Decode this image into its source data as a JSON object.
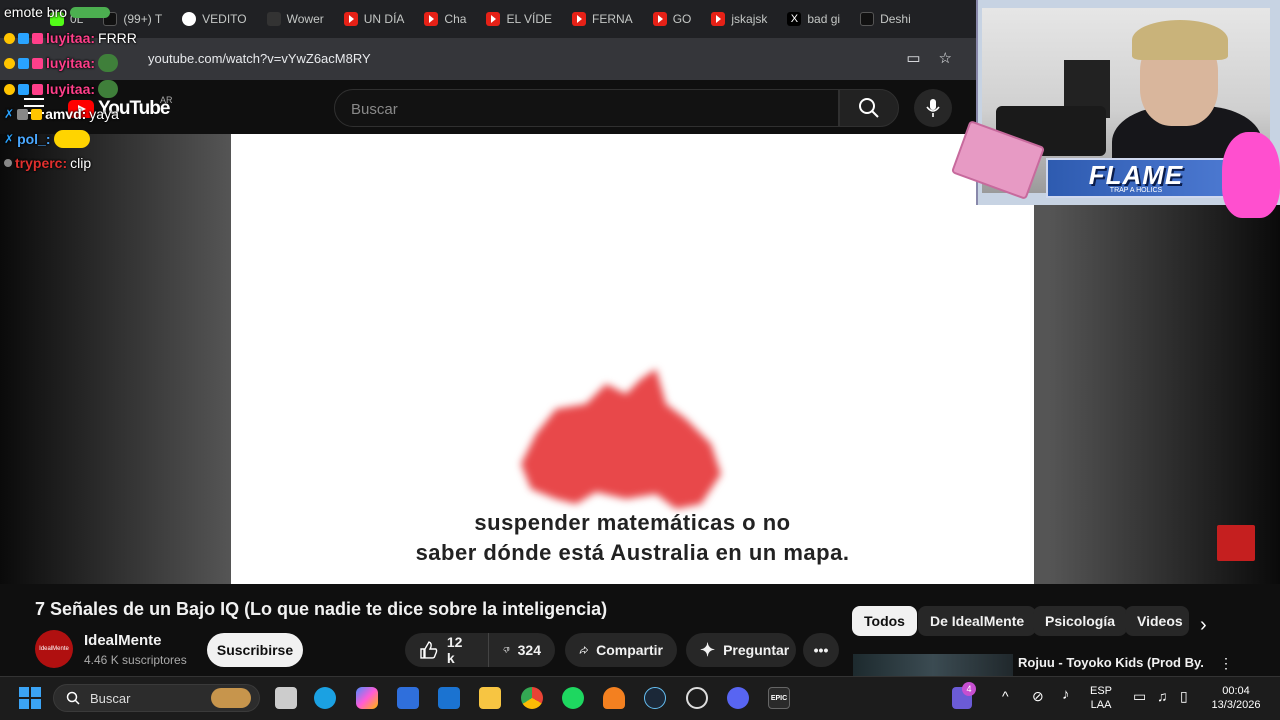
{
  "browser": {
    "tabs": [
      {
        "label": "0L",
        "icon": "kick-icon"
      },
      {
        "label": "(99+) T",
        "icon": "tiktok-icon"
      },
      {
        "label": "VEDITO",
        "icon": "google-icon"
      },
      {
        "label": "Wower",
        "icon": "seven-icon"
      },
      {
        "label": "UN DÍA",
        "icon": "youtube-icon"
      },
      {
        "label": "Cha",
        "icon": "youtube-icon"
      },
      {
        "label": "EL VÍDE",
        "icon": "youtube-icon"
      },
      {
        "label": "FERNA",
        "icon": "youtube-icon"
      },
      {
        "label": "GO",
        "icon": "youtube-icon"
      },
      {
        "label": "jskajsk",
        "icon": "youtube-icon"
      },
      {
        "label": "bad gi",
        "icon": "x-icon"
      },
      {
        "label": "Deshi",
        "icon": "tiktok-icon"
      }
    ],
    "url": "youtube.com/watch?v=vYwZ6acM8RY"
  },
  "youtube": {
    "logo": "YouTube",
    "country": "AR",
    "search_placeholder": "Buscar"
  },
  "video": {
    "subtitle_line1": "suspender matemáticas o no",
    "subtitle_line2": "saber dónde está Australia en un mapa.",
    "title": "7 Señales de un Bajo IQ (Lo que nadie te dice sobre la inteligencia)",
    "channel": "IdealMente",
    "channel_avatar_text": "IdealMente",
    "subscribers": "4.46 K suscriptores",
    "subscribe_label": "Suscribirse",
    "likes": "12 k",
    "dislikes": "324",
    "share_label": "Compartir",
    "ask_label": "Preguntar"
  },
  "chips": [
    "Todos",
    "De IdealMente",
    "Psicología",
    "Videos"
  ],
  "recommendation": {
    "title": "Rojuu - Toyoko Kids (Prod By."
  },
  "chat": [
    {
      "user": "emote bro",
      "text": "",
      "color": "#ffffff"
    },
    {
      "user": "luyitaa:",
      "text": "FRRR",
      "color": "#ff3f8a"
    },
    {
      "user": "luyitaa:",
      "text": "",
      "color": "#ff3f8a"
    },
    {
      "user": "luyitaa:",
      "text": "",
      "color": "#ff3f8a"
    },
    {
      "user": "amvd:",
      "text": "yaya",
      "color": "#ffffff"
    },
    {
      "user": "pol_:",
      "text": "",
      "color": "#4aa8ff"
    },
    {
      "user": "tryperc:",
      "text": "clip",
      "color": "#e0302e"
    }
  ],
  "webcam": {
    "banner": "FLAME",
    "banner_sub": "TRAP A HOLICS"
  },
  "taskbar": {
    "search_label": "Buscar",
    "notif_count": "4",
    "lang": "ESP",
    "layout": "LAA",
    "time": "00:04",
    "date": "13/3/2026"
  },
  "colors": {
    "yt_red": "#ff0000",
    "australia": "#e8484a",
    "bg": "#0f0f0f"
  }
}
